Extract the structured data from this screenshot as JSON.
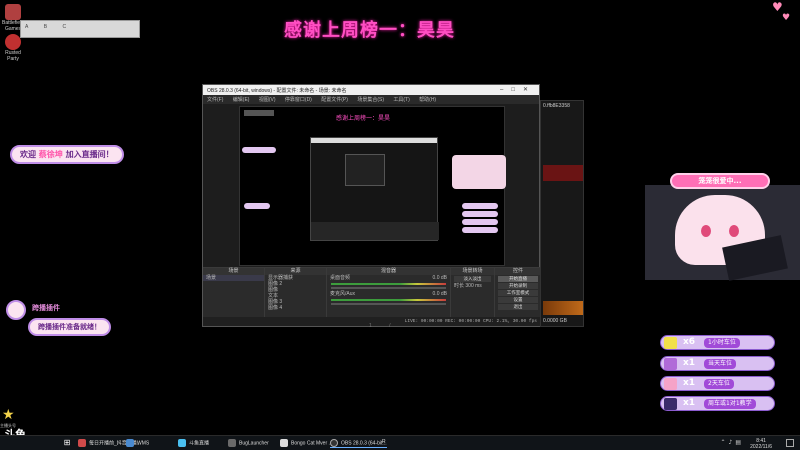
{
  "desktop": {
    "icons": [
      {
        "label": "Battlefield Games",
        "color": "#b04040"
      },
      {
        "label": "Rusted Party",
        "color": "#c03030"
      }
    ],
    "strip_items": [
      "A",
      "B",
      "C"
    ]
  },
  "banner": {
    "title": "感谢上周榜一：昊昊"
  },
  "widgets": {
    "welcome": {
      "prefix": "欢迎",
      "name": "蔡徐坤",
      "suffix": "加入直播间！"
    },
    "plugin_title": "跨播插件",
    "plugin_text": "跨播插件准备就绪！",
    "waiting": "笼笼很爱中...",
    "star_label": "主播头号"
  },
  "obs": {
    "title": "OBS 28.0.3 (64-bit, windows) - 配置文件: 未命名 - 场景: 未命名",
    "menu": [
      "文件(F)",
      "编辑(E)",
      "视图(V)",
      "停靠窗口(D)",
      "配置文件(P)",
      "场景集合(S)",
      "工具(T)",
      "帮助(H)"
    ],
    "preview_title": "感谢上周榜一：昊昊",
    "docks": {
      "scenes": {
        "header": "场景",
        "rows": [
          "场景"
        ]
      },
      "sources": {
        "header": "来源",
        "rows": [
          "显示器捕获",
          "图像 2",
          "图像",
          "文本",
          "图像 3",
          "图像 4"
        ]
      },
      "mixer": {
        "header": "混音器",
        "tracks": [
          {
            "name": "桌面音频",
            "level": "0.0 dB"
          },
          {
            "name": "麦克风/Aux",
            "level": "0.0 dB"
          }
        ]
      },
      "transitions": {
        "header": "场景转场",
        "type": "淡入淡出",
        "duration_label": "时长",
        "duration": "300 ms"
      },
      "controls": {
        "header": "控件",
        "buttons": [
          "开始直播",
          "开始录制",
          "工作室模式",
          "设置",
          "退出"
        ]
      }
    },
    "status": "LIVE: 00:00:00   REC: 00:00:00   CPU: 2.1%, 30.00 fps"
  },
  "obs_back": {
    "title": "0.ffb8E3358",
    "footer": "0.0000 GB"
  },
  "pager": {
    "page": "1",
    "of": "/"
  },
  "fleet": [
    {
      "mult": "x6",
      "label": "1小时车位",
      "icon_color": "#f2e04a"
    },
    {
      "mult": "x1",
      "label": "当天车位",
      "icon_color": "#b06ad8"
    },
    {
      "mult": "x1",
      "label": "2天车位",
      "icon_color": "#f5a3c8"
    },
    {
      "mult": "x1",
      "label": "周车或1对1教学",
      "icon_color": "#3a2a6a"
    }
  ],
  "taskbar": {
    "items": [
      {
        "label": "每日开播前_抖音直播...",
        "color": "#d04a4a"
      },
      {
        "label": "WMS",
        "color": "#4a8ad0"
      },
      {
        "label": "斗鱼直播",
        "color": "#4ac0f0"
      },
      {
        "label": "BugLauncher",
        "color": "#6a6a6a"
      },
      {
        "label": "Bongo Cat Mver ...",
        "color": "#dddddd"
      },
      {
        "label": "OBS 28.0.3 (64-bit...",
        "color": "#333333"
      },
      {
        "label": "R",
        "color": "#222222"
      }
    ],
    "time": "8:41",
    "date": "2022/11/6",
    "logo": "斗鱼"
  },
  "colors": {
    "accent_pink": "#ff4fc3",
    "panel_purple": "#a14ad8"
  }
}
